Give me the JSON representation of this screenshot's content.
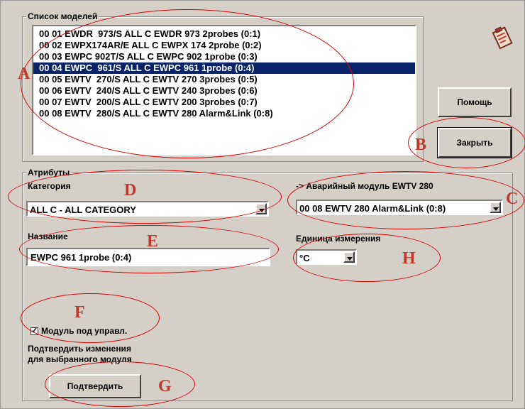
{
  "models_list": {
    "title": "Список моделей",
    "items": [
      "00 01 EWDR  973/S ALL C EWDR 973 2probes (0:1)",
      "00 02 EWPX174AR/E ALL C EWPX 174 2probe (0:2)",
      "00 03 EWPC 902T/S ALL C EWPC 902 1probe (0:3)",
      "00 04 EWPC  961/S ALL C EWPC 961 1probe (0:4)",
      "00 05 EWTV  270/S ALL C EWTV 270 3probes (0:5)",
      "00 06 EWTV  240/S ALL C EWTV 240 3probes (0:6)",
      "00 07 EWTV  200/S ALL C EWTV 200 3probes (0:7)",
      "00 08 EWTV  280/S ALL C EWTV 280 Alarm&Link (0:8)"
    ],
    "selected_index": 3
  },
  "buttons": {
    "help": "Помощь",
    "close": "Закрыть",
    "confirm": "Подтвердить"
  },
  "attributes": {
    "title": "Атрибуты",
    "category_label": "Категория",
    "category_value": "ALL C - ALL CATEGORY",
    "alarm_label": "-> Аварийный модуль EWTV 280",
    "alarm_value": "00 08 EWTV 280 Alarm&Link (0:8)",
    "name_label": "Название",
    "name_value": "EWPC 961 1probe (0:4)",
    "unit_label": "Единица измерения",
    "unit_value": "°C",
    "module_checkbox_label": "Модуль под управл.",
    "module_checkbox_checked": true,
    "confirm_text_line1": "Подтвердить изменения",
    "confirm_text_line2": "для выбранного модуля"
  },
  "annotations": {
    "A": "A",
    "B": "B",
    "C": "C",
    "D": "D",
    "E": "E",
    "F": "F",
    "G": "G",
    "H": "H",
    "color": "#e00000",
    "letter_color": "#c0392b"
  },
  "icons": {
    "app_icon": "clipboard-icon"
  }
}
